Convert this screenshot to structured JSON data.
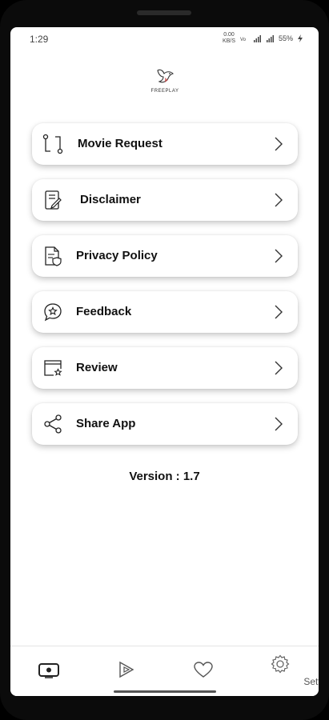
{
  "status_bar": {
    "time": "1:29",
    "speed_top": "0.00",
    "speed_bottom": "KB/S",
    "battery": "55%"
  },
  "logo": {
    "text": "FREEPLAY",
    "icon": "bird-icon"
  },
  "menu": [
    {
      "label": "Movie Request",
      "icon": "route-icon"
    },
    {
      "label": "Disclaimer",
      "icon": "document-pen-icon"
    },
    {
      "label": "Privacy Policy",
      "icon": "document-shield-icon"
    },
    {
      "label": "Feedback",
      "icon": "chat-star-icon"
    },
    {
      "label": "Review",
      "icon": "window-star-icon"
    },
    {
      "label": "Share App",
      "icon": "share-icon"
    }
  ],
  "version": "Version : 1.7",
  "bottom_nav": [
    {
      "icon": "tv-icon",
      "label": ""
    },
    {
      "icon": "play-icon",
      "label": ""
    },
    {
      "icon": "heart-icon",
      "label": ""
    },
    {
      "icon": "gear-icon",
      "label": "Setting"
    }
  ]
}
